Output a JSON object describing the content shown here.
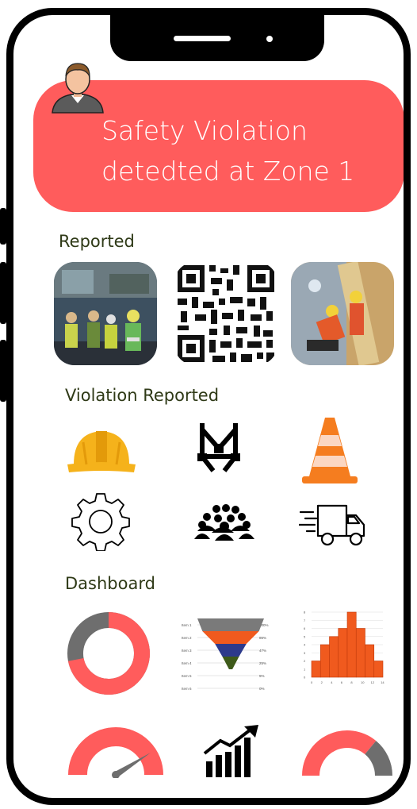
{
  "notification": {
    "line1": "Safety Violation",
    "line2": "detedted at Zone 1",
    "color": "#ff5c5c"
  },
  "sections": {
    "reported": "Reported",
    "violation": "Violation Reported",
    "dashboard": "Dashboard"
  },
  "reported_items": [
    {
      "name": "site-photo-workers"
    },
    {
      "name": "qr-code"
    },
    {
      "name": "site-photo-worker-climbing"
    }
  ],
  "violation_icons": [
    "hard-hat-icon",
    "safety-harness-icon",
    "traffic-cone-icon",
    "gear-icon",
    "crowd-icon",
    "delivery-truck-icon"
  ],
  "dashboard": {
    "funnel": {
      "labels": [
        "Item 1",
        "Item 2",
        "Item 3",
        "Item 4",
        "Item 5",
        "Item 6"
      ],
      "percents": [
        "100%",
        "85%",
        "47%",
        "25%",
        "5%",
        "0%"
      ]
    },
    "histogram": {
      "values": [
        2,
        4,
        5,
        6,
        8,
        6,
        4,
        2
      ],
      "y_ticks": [
        "0",
        "1",
        "2",
        "3",
        "4",
        "5",
        "6",
        "7",
        "8"
      ],
      "x_ticks": [
        "0",
        "2",
        "4",
        "6",
        "8",
        "10",
        "12",
        "14"
      ]
    },
    "donut_fraction": 0.72,
    "gauge_value": 0.82,
    "half_donut_fraction": 0.72,
    "colors": {
      "accent": "#ff5c5c",
      "gray": "#6e6e6e",
      "histogram": "#f05a1e"
    }
  }
}
